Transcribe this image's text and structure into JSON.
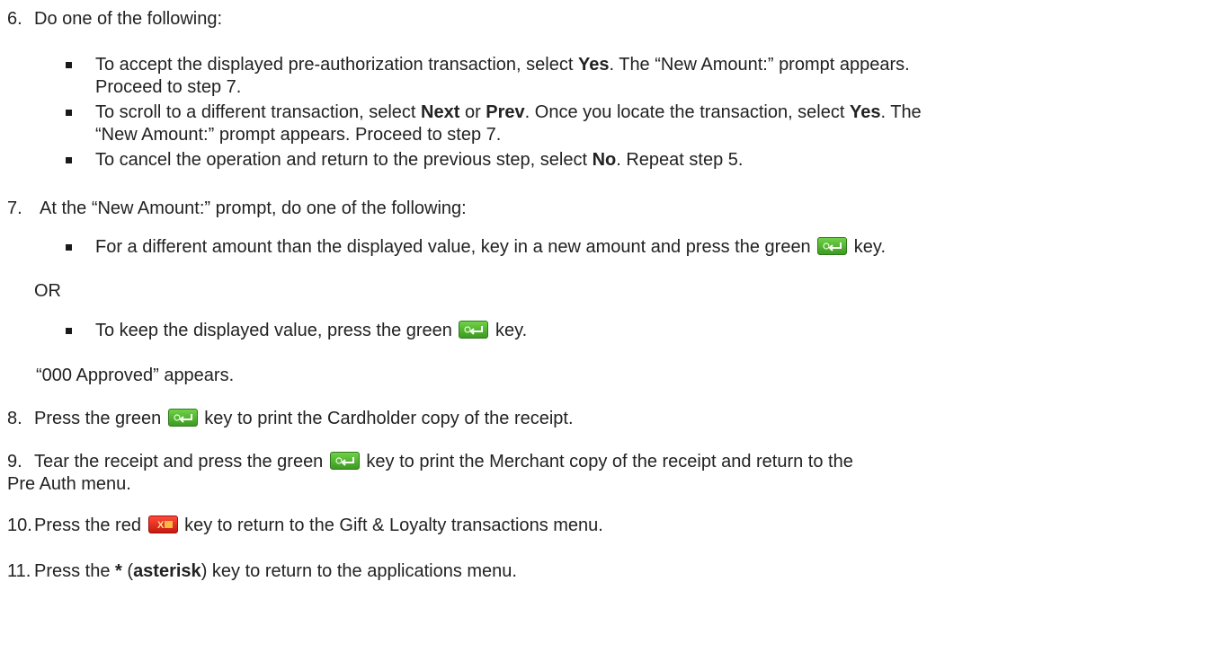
{
  "steps": {
    "s6": {
      "num": "6.",
      "text": "Do one of the following:",
      "b1": {
        "a": "To accept the displayed pre-authorization transaction, select ",
        "yes": "Yes",
        "b": ". The “New Amount:” prompt appears.",
        "c": "Proceed to step 7."
      },
      "b2": {
        "a": "To scroll to a different transaction, select ",
        "next": "Next",
        "or": " or ",
        "prev": "Prev",
        "b": ". Once you locate the transaction, select ",
        "yes": "Yes",
        "c": ". The",
        "d": "“New Amount:” prompt appears. Proceed to step 7."
      },
      "b3": {
        "a": "To cancel the operation and return to the previous step, select ",
        "no": "No",
        "b": ". Repeat step 5."
      }
    },
    "s7": {
      "num": "7.",
      "text": "At the “New Amount:” prompt, do one of the following:",
      "b1": {
        "a": "For a different amount than the displayed value, key in a new amount and press the green ",
        "b": " key."
      },
      "or": "OR",
      "b2": {
        "a": "To keep the displayed value, press the green ",
        "b": " key."
      },
      "approved": "“000 Approved” appears."
    },
    "s8": {
      "num": "8.",
      "a": "Press the green ",
      "b": " key to print the Cardholder copy of the receipt."
    },
    "s9": {
      "num": "9.",
      "a": "Tear the receipt and press the green ",
      "b": " key to print the Merchant copy of the receipt and return to the",
      "c": "Pre Auth menu."
    },
    "s10": {
      "num": "10.",
      "a": "Press the red ",
      "b": " key to return to the Gift & Loyalty transactions menu."
    },
    "s11": {
      "num": "11.",
      "a": "Press the ",
      "star": "*",
      "b": " (",
      "asterisk": "asterisk",
      "c": ") key to return to the applications menu."
    }
  },
  "icons": {
    "green_key": "enter-key-icon",
    "red_key": "cancel-key-icon",
    "green_color": "#4caf2a",
    "red_color": "#e0261a"
  }
}
